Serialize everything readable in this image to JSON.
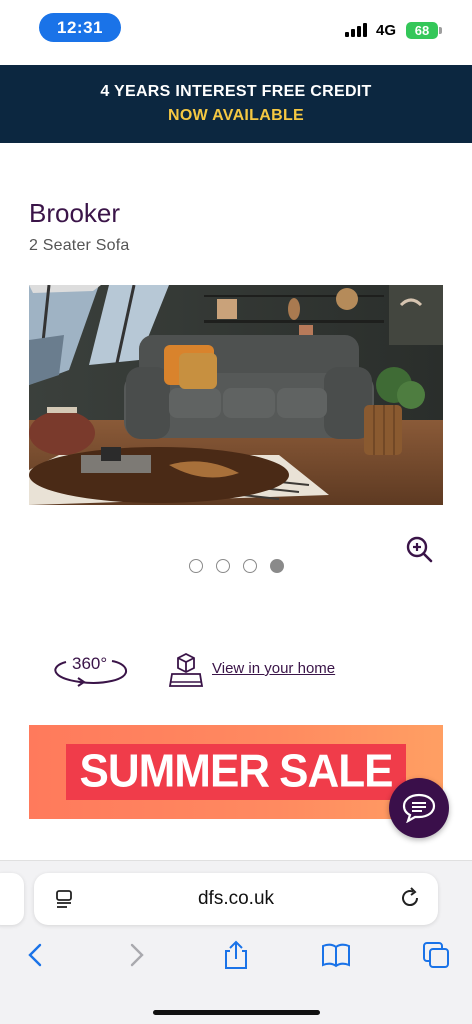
{
  "status_bar": {
    "time": "12:31",
    "network": "4G",
    "battery": "68"
  },
  "promo": {
    "line1": "4 YEARS INTEREST FREE CREDIT",
    "line2": "NOW AVAILABLE"
  },
  "product": {
    "name": "Brooker",
    "subtitle": "2 Seater Sofa"
  },
  "carousel": {
    "total": 4,
    "active_index": 3
  },
  "tools": {
    "spin_label": "360°",
    "ar_link": "View in your home"
  },
  "sale_banner": {
    "word1": "SUMMER",
    "word2": "SALE"
  },
  "browser": {
    "url": "dfs.co.uk"
  },
  "colors": {
    "brand_purple": "#3a1448",
    "promo_bg": "#0c2740",
    "promo_accent": "#f5c842",
    "ios_blue": "#1a73e8"
  }
}
